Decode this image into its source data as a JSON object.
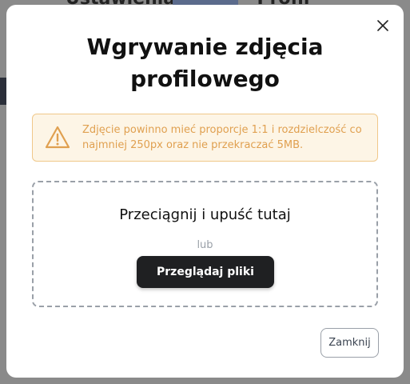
{
  "backdrop": {
    "heading": "Ustawienia konta - Profil"
  },
  "modal": {
    "title": "Wgrywanie zdjęcia profilowego",
    "close_icon": "close-icon",
    "warning": {
      "icon": "warning-triangle-icon",
      "text": "Zdjęcie powinno mieć proporcje 1:1 i rozdzielczość co najmniej 250px oraz nie przekraczać 5MB."
    },
    "dropzone": {
      "prompt": "Przeciągnij i upuść tutaj",
      "separator": "lub",
      "browse_label": "Przeglądaj pliki"
    },
    "dismiss_label": "Zamknij"
  },
  "colors": {
    "warning_bg": "#fdf5e6",
    "warning_border": "#f0c88a",
    "warning_text": "#e0a050",
    "primary_button": "#1f2022"
  }
}
